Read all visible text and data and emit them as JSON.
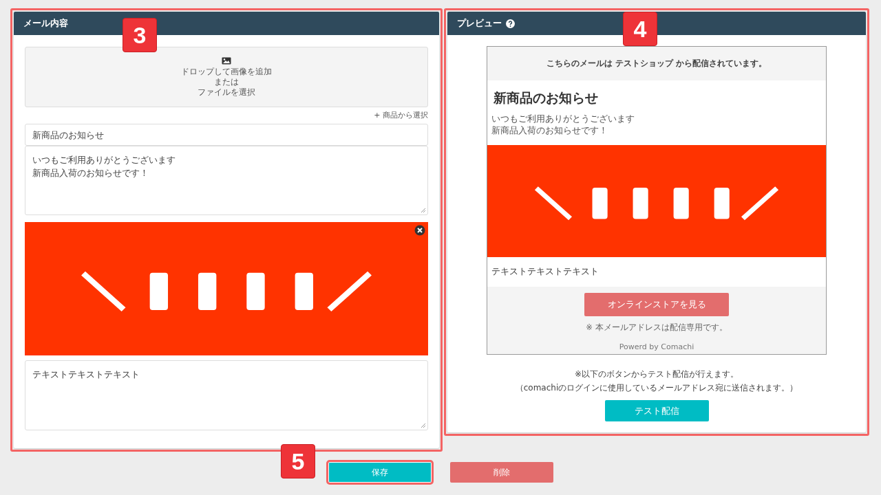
{
  "editor": {
    "title": "メール内容",
    "highlighted": true,
    "dropzone": {
      "lines": [
        "ドロップして画像を追加",
        "または",
        "ファイルを選択"
      ]
    },
    "product_link": "+ 商品から選択",
    "subject": "新商品のお知らせ",
    "body": [
      "いつもご利用ありがとうございます",
      "新商品入荷のお知らせです！"
    ],
    "image": {
      "kind": "picture"
    },
    "footer_text": "テキストテキストテキスト"
  },
  "preview": {
    "title": "プレビュー",
    "highlighted": true,
    "header": "こちらのメールは テストショップ から配信されています。",
    "heading": "新商品のお知らせ",
    "body": [
      "いつもご利用ありがとうございます",
      "新商品入荷のお知らせです！"
    ],
    "image": {
      "kind": "picture"
    },
    "text": "テキストテキストテキスト",
    "store_button": "オンラインストアを見る",
    "notice": "※ 本メールアドレスは配信専用です。",
    "powered": "Powerd by Comachi",
    "test_note": "※以下のボタンからテスト配信が行えます。",
    "test_subnote": "（comachiのログインに使用しているメールアドレス宛に送信されます。）",
    "test_button": "テスト配信"
  },
  "actions": [
    {
      "label": "保存",
      "kind": "save",
      "highlighted": true
    },
    {
      "label": "削除",
      "kind": "delete",
      "highlighted": false
    }
  ],
  "annotations": [
    {
      "label": "3"
    },
    {
      "label": "4"
    },
    {
      "label": "5"
    }
  ]
}
